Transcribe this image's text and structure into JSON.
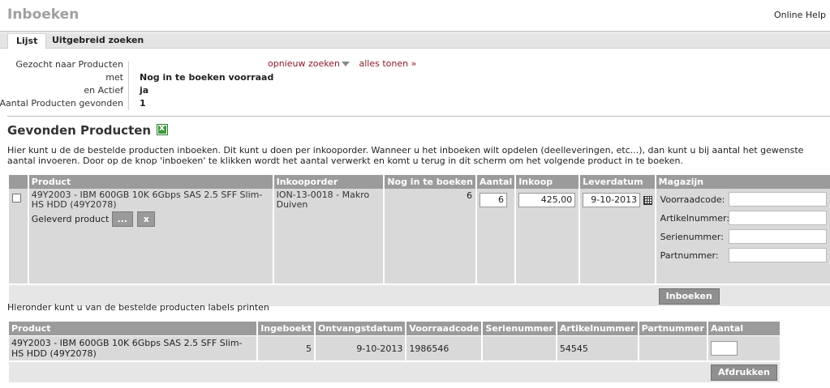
{
  "header": {
    "title": "Inboeken",
    "help": "Online Help"
  },
  "tabs": [
    {
      "label": "Lijst"
    },
    {
      "label": "Uitgebreid zoeken"
    }
  ],
  "criteria": {
    "rows": [
      {
        "label": "Gezocht naar Producten",
        "value": ""
      },
      {
        "label": "met",
        "value": "Nog in te boeken voorraad"
      },
      {
        "label": "en Actief",
        "value": "ja"
      },
      {
        "label": "Aantal Producten gevonden",
        "value": "1"
      }
    ],
    "new_search": "opnieuw zoeken",
    "show_all": "alles tonen »"
  },
  "section": {
    "title": "Gevonden Producten",
    "intro": "Hier kunt u de de bestelde producten inboeken. Dit kunt u doen per inkooporder. Wanneer u het inboeken wilt opdelen (deelleveringen, etc...), dan kunt u bij aantal het gewenste aantal invoeren. Door op de knop 'inboeken' te klikken wordt het aantal verwerkt en komt u terug in dit scherm om het volgende product in te boeken."
  },
  "table1": {
    "headers": [
      "Product",
      "Inkooporder",
      "Nog in te boeken",
      "Aantal",
      "Inkoop",
      "Leverdatum",
      "Magazijn"
    ],
    "row": {
      "product": "49Y2003 - IBM 600GB 10K 6Gbps SAS 2.5 SFF Slim-HS HDD (49Y2078)",
      "delivered_label": "Geleverd product",
      "dots": "...",
      "clear": "x",
      "inkooporder": "ION-13-0018 - Makro Duiven",
      "remaining": "6",
      "quantity": "6",
      "price": "425,00",
      "date": "9-10-2013"
    },
    "magazijn_fields": [
      "Voorraadcode:",
      "Artikelnummer:",
      "Serienummer:",
      "Partnummer:"
    ],
    "submit": "Inboeken"
  },
  "labels_text": "Hieronder kunt u van de bestelde producten labels printen",
  "table2": {
    "headers": [
      "Product",
      "Ingeboekt",
      "Ontvangstdatum",
      "Voorraadcode",
      "Serienummer",
      "Artikelnummer",
      "Partnummer",
      "Aantal"
    ],
    "row": {
      "product": "49Y2003 - IBM 600GB 10K 6Gbps SAS 2.5 SFF Slim-HS HDD (49Y2078)",
      "ingeboekt": "5",
      "date": "9-10-2013",
      "voorraadcode": "1986546",
      "serienummer": "",
      "artikelnummer": "54545",
      "partnummer": ""
    },
    "print": "Afdrukken"
  }
}
